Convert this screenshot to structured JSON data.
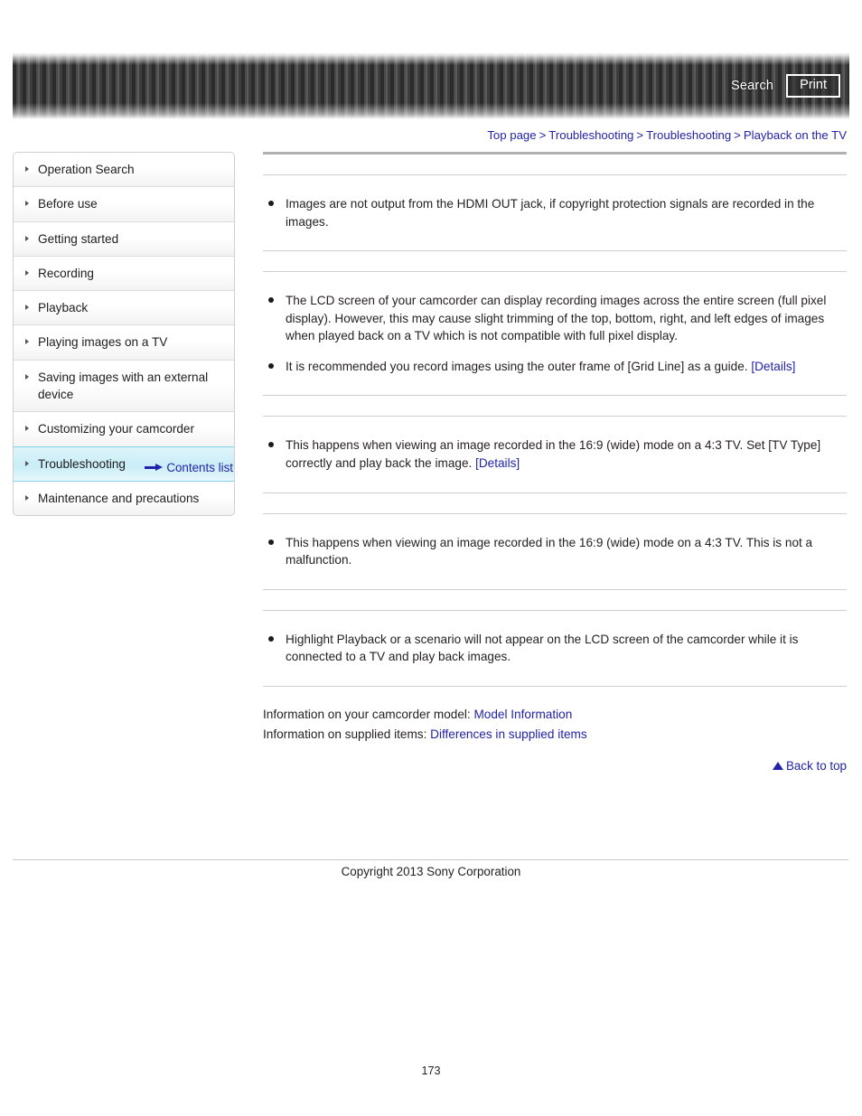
{
  "header": {
    "search_label": "Search",
    "print_label": "Print"
  },
  "breadcrumb": {
    "items": [
      {
        "label": "Top page"
      },
      {
        "label": "Troubleshooting"
      },
      {
        "label": "Troubleshooting"
      },
      {
        "label": "Playback on the TV"
      }
    ],
    "separator": ">"
  },
  "sidebar": {
    "items": [
      {
        "label": "Operation Search",
        "active": false
      },
      {
        "label": "Before use",
        "active": false
      },
      {
        "label": "Getting started",
        "active": false
      },
      {
        "label": "Recording",
        "active": false
      },
      {
        "label": "Playback",
        "active": false
      },
      {
        "label": "Playing images on a TV",
        "active": false
      },
      {
        "label": "Saving images with an external device",
        "active": false
      },
      {
        "label": "Customizing your camcorder",
        "active": false
      },
      {
        "label": "Troubleshooting",
        "active": true
      },
      {
        "label": "Maintenance and precautions",
        "active": false
      }
    ],
    "contents_list_label": "Contents list"
  },
  "main": {
    "sections": [
      {
        "heading": "",
        "bullets": [
          {
            "text": "Images are not output from the HDMI OUT jack, if copyright protection signals are recorded in the images.",
            "link": ""
          }
        ]
      },
      {
        "heading": "",
        "bullets": [
          {
            "text": "The LCD screen of your camcorder can display recording images across the entire screen (full pixel display). However, this may cause slight trimming of the top, bottom, right, and left edges of images when played back on a TV which is not compatible with full pixel display.",
            "link": ""
          },
          {
            "text": "It is recommended you record images using the outer frame of [Grid Line] as a guide.",
            "link": "[Details]"
          }
        ]
      },
      {
        "heading": "",
        "bullets": [
          {
            "text": "This happens when viewing an image recorded in the 16:9 (wide) mode on a 4:3 TV. Set [TV Type] correctly and play back the image.",
            "link": "[Details]"
          }
        ]
      },
      {
        "heading": "",
        "bullets": [
          {
            "text": "This happens when viewing an image recorded in the 16:9 (wide) mode on a 4:3 TV. This is not a malfunction.",
            "link": ""
          }
        ]
      },
      {
        "heading": "",
        "bullets": [
          {
            "text": "Highlight Playback or a scenario will not appear on the LCD screen of the camcorder while it is connected to a TV and play back images.",
            "link": ""
          }
        ]
      }
    ],
    "info": {
      "model_prefix": "Information on your camcorder model:",
      "model_link": "Model Information",
      "supplied_prefix": "Information on supplied items:",
      "supplied_link": "Differences in supplied items"
    },
    "back_to_top_label": "Back to top"
  },
  "footer": {
    "copyright": "Copyright 2013 Sony Corporation",
    "page_number": "173"
  },
  "colors": {
    "link": "#2222aa",
    "active_nav": "#c9edf7",
    "header_bg": "#3a3a3a"
  }
}
